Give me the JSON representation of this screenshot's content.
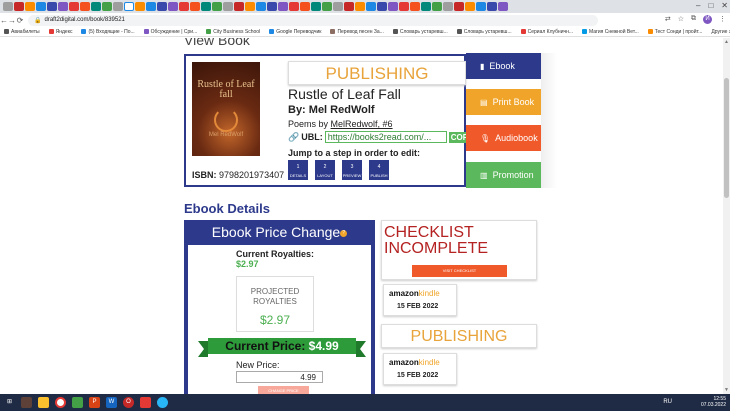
{
  "browser": {
    "url": "draft2digital.com/book/839521",
    "tab_count": 46,
    "profile_initial": "И",
    "bookmarks": [
      {
        "label": "Авиабилеты",
        "color": "#555"
      },
      {
        "label": "Яндекс",
        "color": "#e53935"
      },
      {
        "label": "(5) Входящие - По...",
        "color": "#1e88e5"
      },
      {
        "label": "Обсуждение | Сри...",
        "color": "#7e57c2"
      },
      {
        "label": "City Business School",
        "color": "#43a047"
      },
      {
        "label": "Google Переводчик",
        "color": "#1e88e5"
      },
      {
        "label": "Перевод песен За...",
        "color": "#8d6e63"
      },
      {
        "label": "Словарь устаревш...",
        "color": "#555"
      },
      {
        "label": "Словарь устаревш...",
        "color": "#555"
      },
      {
        "label": "Сериал Клубничн...",
        "color": "#e53935"
      },
      {
        "label": "Магия Снежной Вет...",
        "color": "#039be5"
      },
      {
        "label": "Тест Сонди | пройт...",
        "color": "#fb8c00"
      }
    ],
    "other_bookmarks": "Другие закладки"
  },
  "page": {
    "section_title": "View Book",
    "book": {
      "status_banner": "PUBLISHING",
      "title": "Rustle of Leaf Fall",
      "author": "By: Mel RedWolf",
      "series_prefix": "Poems by ",
      "series_link": "MelRedwolf, #6",
      "ubl_label": "UBL:",
      "ubl_url": "https://books2read.com/...",
      "copy_label": "COP",
      "jump_label": "Jump to a step in order to edit:",
      "steps": [
        {
          "num": "1",
          "label": "DETAILS"
        },
        {
          "num": "2",
          "label": "LAYOUT"
        },
        {
          "num": "3",
          "label": "PREVIEW"
        },
        {
          "num": "4",
          "label": "PUBLISH"
        }
      ],
      "isbn_label": "ISBN:",
      "isbn": "9798201973407",
      "cover_title": "Rustle of Leaf fall",
      "cover_author": "Mel RedWolf"
    },
    "side_buttons": [
      {
        "label": "Ebook",
        "icon": "book-icon",
        "color": "#2d3a8c"
      },
      {
        "label": "Print Book",
        "icon": "print-book-icon",
        "color": "#f0a52a"
      },
      {
        "label": "Audiobook",
        "icon": "microphone-icon",
        "color": "#f0592a"
      },
      {
        "label": "Promotion",
        "icon": "bar-chart-icon",
        "color": "#5cb85c"
      }
    ],
    "ebook_details_title": "Ebook Details",
    "price": {
      "header": "Ebook Price Change",
      "current_royalties_label": "Current Royalties:",
      "current_royalties": "$2.97",
      "projected_label": "PROJECTED ROYALTIES",
      "projected_value": "$2.97",
      "current_price_label": "Current Price:",
      "current_price": "$4.99",
      "new_price_label": "New Price:",
      "new_price_value": "4.99",
      "change_button": "CHANGE PRICE"
    },
    "checklist": {
      "title": "CHECKLIST INCOMPLETE",
      "button": "VISIT CHECKLIST"
    },
    "stores": [
      {
        "brand": "amazon",
        "suffix": "kindle",
        "date": "15 FEB 2022"
      },
      {
        "brand": "amazon",
        "suffix": "kindle",
        "date": "15 FEB 2022"
      }
    ],
    "publishing_label": "PUBLISHING"
  },
  "taskbar": {
    "lang": "RU",
    "time": "12:55",
    "date": "07.03.2022"
  }
}
